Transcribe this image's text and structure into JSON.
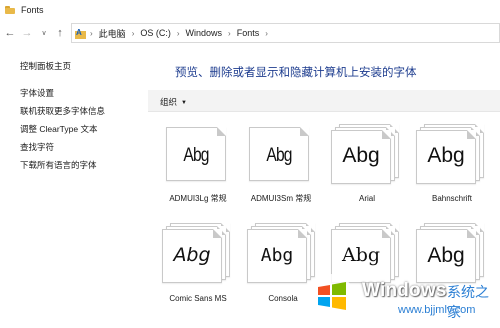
{
  "window": {
    "title": "Fonts"
  },
  "nav": {
    "back": "←",
    "forward": "→",
    "dropdown": "∨",
    "up": "↑",
    "breadcrumbs": [
      "此电脑",
      "OS (C:)",
      "Windows",
      "Fonts"
    ],
    "separator": "›"
  },
  "sidebar": {
    "home": "控制面板主页",
    "links": [
      "字体设置",
      "联机获取更多字体信息",
      "调整 ClearType 文本",
      "查找字符",
      "下载所有语言的字体"
    ]
  },
  "main": {
    "heading": "预览、删除或者显示和隐藏计算机上安装的字体",
    "organize": "组织",
    "organize_caret": "▼"
  },
  "fonts": [
    {
      "sample": "Abg",
      "name": "ADMUI3Lg 常规"
    },
    {
      "sample": "Abg",
      "name": "ADMUI3Sm 常规"
    },
    {
      "sample": "Abg",
      "name": "Arial"
    },
    {
      "sample": "Abg",
      "name": "Bahnschrift"
    },
    {
      "sample": "Abg",
      "name": "Comic Sans MS"
    },
    {
      "sample": "Abg",
      "name": "Consola"
    },
    {
      "sample": "Abg",
      "name": ""
    },
    {
      "sample": "Abg",
      "name": ""
    }
  ],
  "watermark": {
    "brand": "Windows",
    "cn": "系统之家",
    "url": "www.bjjmlv.com"
  },
  "colors": {
    "heading": "#1e3d8f",
    "folder": "#e9b949",
    "watermark_blue": "#2b7fd4"
  }
}
